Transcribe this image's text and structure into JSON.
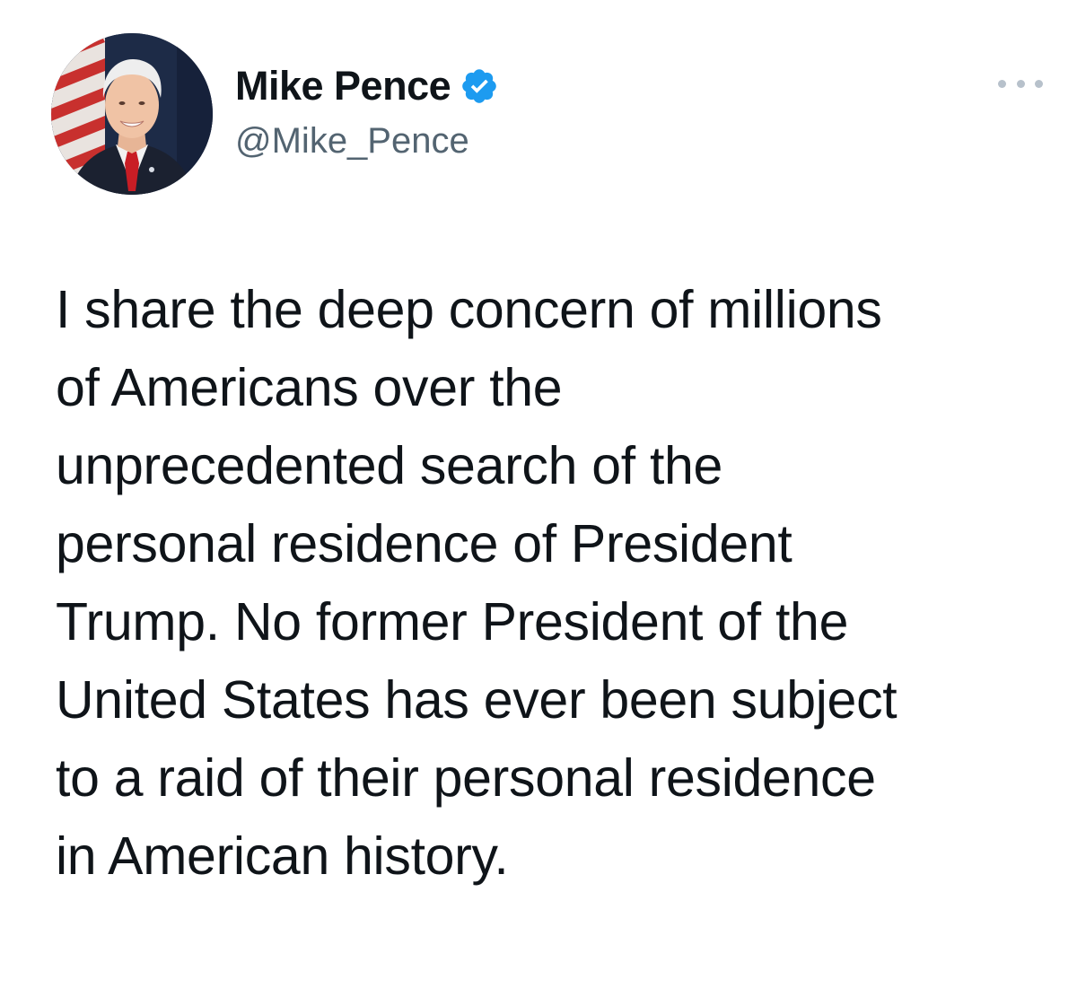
{
  "author": {
    "display_name": "Mike Pence",
    "handle": "@Mike_Pence",
    "verified": true,
    "verified_icon": "verified-badge-icon",
    "avatar_icon": "profile-photo"
  },
  "menu": {
    "icon": "more-options-icon"
  },
  "tweet": {
    "lines": [
      "I share the deep concern of millions",
      "of Americans over the",
      "unprecedented search of the",
      "personal residence of President",
      "Trump. No former President of the",
      "United States has ever been subject",
      "to a raid of their personal residence",
      "in American history."
    ]
  },
  "colors": {
    "text": "#0f1419",
    "handle": "#536471",
    "verified": "#1d9bf0",
    "more_dots": "#b7c1cb"
  }
}
